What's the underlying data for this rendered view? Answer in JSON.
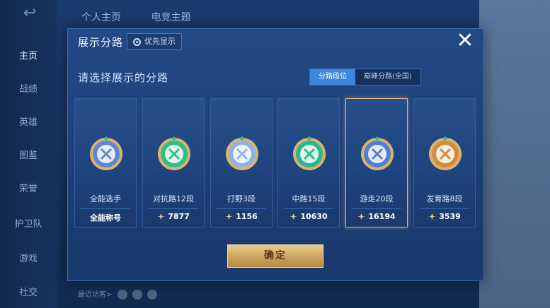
{
  "nav": {
    "items": [
      "主页",
      "战绩",
      "英雄",
      "图鉴",
      "荣誉",
      "护卫队",
      "游戏",
      "社交"
    ]
  },
  "top_tabs": [
    "个人主页",
    "电竞主题"
  ],
  "bottom": {
    "visitors_label": "最近访客>"
  },
  "modal": {
    "title": "展示分路",
    "priority_label": "优先显示",
    "close": "✕",
    "subtitle": "请选择展示的分路",
    "segment": {
      "active": "分路段位",
      "inactive": "巅峰分路(全国)"
    },
    "confirm_label": "确定"
  },
  "cards": [
    {
      "name": "全能选手",
      "value": "全能称号",
      "has_icon": false,
      "badge_color": "#5f86d6",
      "selected": false
    },
    {
      "name": "对抗路12段",
      "value": "7877",
      "has_icon": true,
      "badge_color": "#2fbf86",
      "selected": false
    },
    {
      "name": "打野3段",
      "value": "1156",
      "has_icon": true,
      "badge_color": "#8fb2e6",
      "selected": false
    },
    {
      "name": "中路15段",
      "value": "10630",
      "has_icon": true,
      "badge_color": "#2cb78a",
      "selected": false
    },
    {
      "name": "游走20段",
      "value": "16194",
      "has_icon": true,
      "badge_color": "#4f7fd0",
      "selected": true
    },
    {
      "name": "发育路8段",
      "value": "3539",
      "has_icon": true,
      "badge_color": "#d48a3f",
      "selected": false
    }
  ],
  "colors": {
    "gold": "#e5b57c",
    "accent_blue": "#3e86db"
  }
}
